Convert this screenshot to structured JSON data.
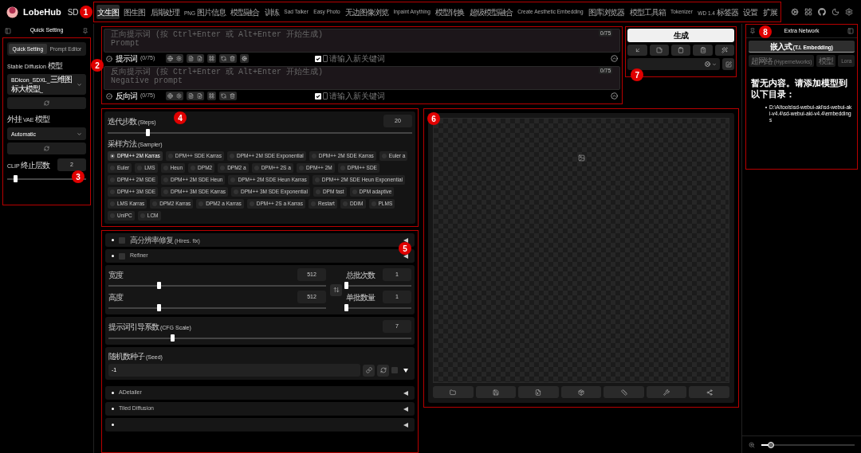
{
  "top_bar": {
    "logo": "LobeHub",
    "app_label": "SD",
    "callout": "1",
    "tabs": [
      {
        "label": "文生图",
        "selected": true
      },
      {
        "label": "图生图",
        "selected": false
      },
      {
        "label": "后期处理",
        "selected": false
      },
      {
        "label": "PNG 图片信息",
        "selected": false
      },
      {
        "label": "模型融合",
        "selected": false
      },
      {
        "label": "训练",
        "selected": false
      },
      {
        "label": "Sad Talker",
        "selected": false
      },
      {
        "label": "Easy Photo",
        "selected": false
      },
      {
        "label": "无边图像浏览",
        "selected": false
      },
      {
        "label": "Inpaint Anything",
        "selected": false
      },
      {
        "label": "模型转换",
        "selected": false
      },
      {
        "label": "超级模型融合",
        "selected": false
      },
      {
        "label": "Create Aesthetic Embedding",
        "selected": false
      },
      {
        "label": "图库浏览器",
        "selected": false
      },
      {
        "label": "模型工具箱",
        "selected": false
      },
      {
        "label": "Tokenizer",
        "selected": false
      },
      {
        "label": "WD 1.4 标签器",
        "selected": false
      },
      {
        "label": "设置",
        "selected": false
      },
      {
        "label": "扩展",
        "selected": false
      }
    ]
  },
  "sidebar": {
    "title": "Quick Setting",
    "callout": "3",
    "tabs": [
      {
        "label": "Quick Setting",
        "selected": true
      },
      {
        "label": "Prompt Editor",
        "selected": false
      }
    ],
    "sd_model": {
      "label": "Stable Diffusion 模型",
      "value": "BDicon_SDXL_三维图标大模型_"
    },
    "vae": {
      "label": "外挂 VAE 模型",
      "value": "Automatic"
    },
    "clip_skip": {
      "label": "CLIP 终止层数",
      "value": "2",
      "level": 0.1
    }
  },
  "prompts": {
    "callout": "2",
    "items": [
      {
        "kind": "positive",
        "placeholder": "正向提示词 (按 Ctrl+Enter 或 Alt+Enter 开始生成)\nPrompt",
        "token_count": "0/75",
        "label": "提示词",
        "count": "(0/75)",
        "keyword_checked": true,
        "keyword_placeholder": "请输入新关键词"
      },
      {
        "kind": "negative",
        "placeholder": "反向提示词 (按 Ctrl+Enter 或 Alt+Enter 开始生成)\nNegative prompt",
        "token_count": "0/75",
        "label": "反向词",
        "count": "(0/75)",
        "keyword_checked": true,
        "keyword_placeholder": "请输入新关键词"
      }
    ]
  },
  "generate": {
    "callout": "7",
    "button": "生成"
  },
  "steps": {
    "callout": "4",
    "label": "迭代步数 (Steps)",
    "value": "20",
    "level": 0.13,
    "sampler_label": "采样方法 (Sampler)",
    "samplers": [
      {
        "label": "DPM++ 2M Karras",
        "selected": true
      },
      {
        "label": "DPM++ SDE Karras",
        "selected": false
      },
      {
        "label": "DPM++ 2M SDE Exponential",
        "selected": false
      },
      {
        "label": "DPM++ 2M SDE Karras",
        "selected": false
      },
      {
        "label": "Euler a",
        "selected": false
      },
      {
        "label": "Euler",
        "selected": false
      },
      {
        "label": "LMS",
        "selected": false
      },
      {
        "label": "Heun",
        "selected": false
      },
      {
        "label": "DPM2",
        "selected": false
      },
      {
        "label": "DPM2 a",
        "selected": false
      },
      {
        "label": "DPM++ 2S a",
        "selected": false
      },
      {
        "label": "DPM++ 2M",
        "selected": false
      },
      {
        "label": "DPM++ SDE",
        "selected": false
      },
      {
        "label": "DPM++ 2M SDE",
        "selected": false
      },
      {
        "label": "DPM++ 2M SDE Heun",
        "selected": false
      },
      {
        "label": "DPM++ 2M SDE Heun Karras",
        "selected": false
      },
      {
        "label": "DPM++ 2M SDE Heun Exponential",
        "selected": false
      },
      {
        "label": "DPM++ 3M SDE",
        "selected": false
      },
      {
        "label": "DPM++ 3M SDE Karras",
        "selected": false
      },
      {
        "label": "DPM++ 3M SDE Exponential",
        "selected": false
      },
      {
        "label": "DPM fast",
        "selected": false
      },
      {
        "label": "DPM adaptive",
        "selected": false
      },
      {
        "label": "LMS Karras",
        "selected": false
      },
      {
        "label": "DPM2 Karras",
        "selected": false
      },
      {
        "label": "DPM2 a Karras",
        "selected": false
      },
      {
        "label": "DPM++ 2S a Karras",
        "selected": false
      },
      {
        "label": "Restart",
        "selected": false
      },
      {
        "label": "DDIM",
        "selected": false
      },
      {
        "label": "PLMS",
        "selected": false
      },
      {
        "label": "UniPC",
        "selected": false
      },
      {
        "label": "LCM",
        "selected": false
      }
    ]
  },
  "settings": {
    "callout": "5",
    "accordions_top": [
      {
        "label": "高分辨率修复 (Hires. fix)",
        "checked": false
      },
      {
        "label": "Refiner",
        "checked": false
      }
    ],
    "size": [
      {
        "label": "宽度",
        "value": "512",
        "level": 0.23
      },
      {
        "label": "高度",
        "value": "512",
        "level": 0.23
      }
    ],
    "batch": [
      {
        "label": "总批次数",
        "value": "1",
        "level": 0
      },
      {
        "label": "单批数量",
        "value": "1",
        "level": 0
      }
    ],
    "cfg": {
      "label": "提示词引导系数 (CFG Scale)",
      "value": "7",
      "level": 0.21
    },
    "seed": {
      "label": "随机数种子 (Seed)",
      "value": "-1",
      "extra_checked": false
    },
    "accordions_bottom": [
      {
        "label": "ADetailer"
      },
      {
        "label": "Tiled Diffusion"
      }
    ]
  },
  "preview": {
    "callout": "6"
  },
  "extra_network": {
    "callout": "8",
    "title": "Extra Network",
    "tabs": [
      {
        "label": "嵌入式 (T.I. Embedding)",
        "selected": true
      },
      {
        "label": "超网络 (Hypernetworks)",
        "selected": false
      },
      {
        "label": "模型",
        "selected": false
      },
      {
        "label": "Lora",
        "selected": false
      }
    ],
    "empty_message": "暂无内容。请添加模型到以下目录：",
    "paths": [
      "D:\\AItools\\sd-webui-aki\\sd-webui-aki-v4.4\\sd-webui-aki-v4.4\\embeddings"
    ],
    "zoom": {
      "level": 0.1
    }
  }
}
